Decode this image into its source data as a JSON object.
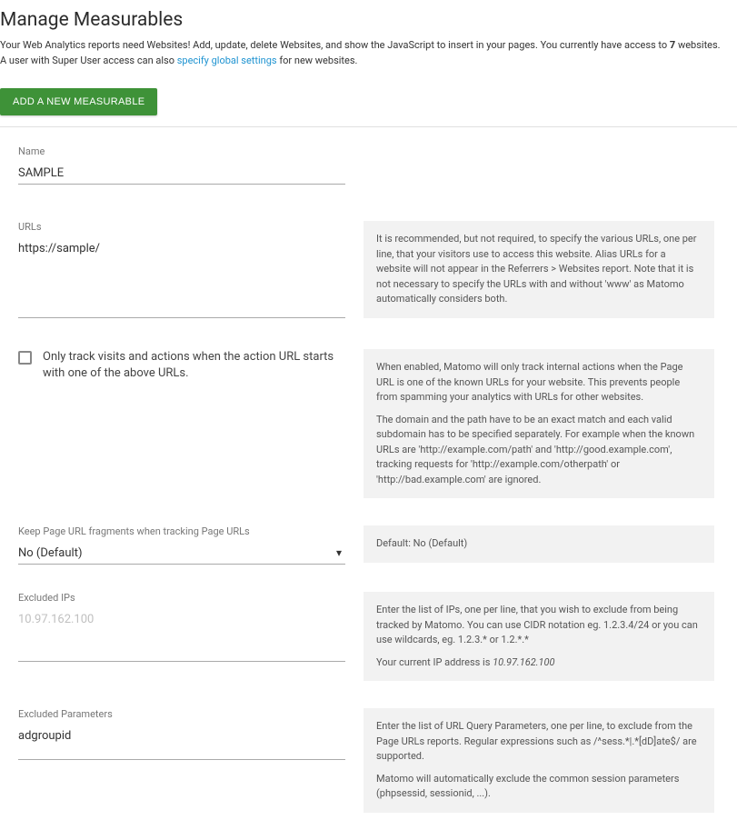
{
  "page_title": "Manage Measurables",
  "description": {
    "line1_a": "Your Web Analytics reports need Websites! Add, update, delete Websites, and show the JavaScript to insert in your pages. You currently have access to ",
    "line1_count": "7",
    "line1_b": " websites.",
    "line2_a": "A user with Super User access can also ",
    "line2_link": "specify global settings",
    "line2_b": " for new websites."
  },
  "add_button": "ADD A NEW MEASURABLE",
  "fields": {
    "name": {
      "label": "Name",
      "value": "SAMPLE"
    },
    "urls": {
      "label": "URLs",
      "value": "https://sample/",
      "help": "It is recommended, but not required, to specify the various URLs, one per line, that your visitors use to access this website. Alias URLs for a website will not appear in the Referrers > Websites report. Note that it is not necessary to specify the URLs with and without 'www' as Matomo automatically considers both."
    },
    "only_track": {
      "label": "Only track visits and actions when the action URL starts with one of the above URLs.",
      "help_p1": "When enabled, Matomo will only track internal actions when the Page URL is one of the known URLs for your website. This prevents people from spamming your analytics with URLs for other websites.",
      "help_p2": "The domain and the path have to be an exact match and each valid subdomain has to be specified separately. For example when the known URLs are 'http://example.com/path' and 'http://good.example.com', tracking requests for 'http://example.com/otherpath' or 'http://bad.example.com' are ignored."
    },
    "keep_fragments": {
      "label": "Keep Page URL fragments when tracking Page URLs",
      "value": "No (Default)",
      "help": "Default: No (Default)"
    },
    "excluded_ips": {
      "label": "Excluded IPs",
      "placeholder": "10.97.162.100",
      "help_p1": "Enter the list of IPs, one per line, that you wish to exclude from being tracked by Matomo. You can use CIDR notation eg. 1.2.3.4/24 or you can use wildcards, eg. 1.2.3.* or 1.2.*.*",
      "help_p2a": "Your current IP address is ",
      "help_p2_ip": "10.97.162.100"
    },
    "excluded_params": {
      "label": "Excluded Parameters",
      "value": "adgroupid",
      "help_p1": "Enter the list of URL Query Parameters, one per line, to exclude from the Page URLs reports. Regular expressions such as /^sess.*|.*[dD]ate$/ are supported.",
      "help_p2": "Matomo will automatically exclude the common session parameters (phpsessid, sessionid, ...)."
    }
  }
}
